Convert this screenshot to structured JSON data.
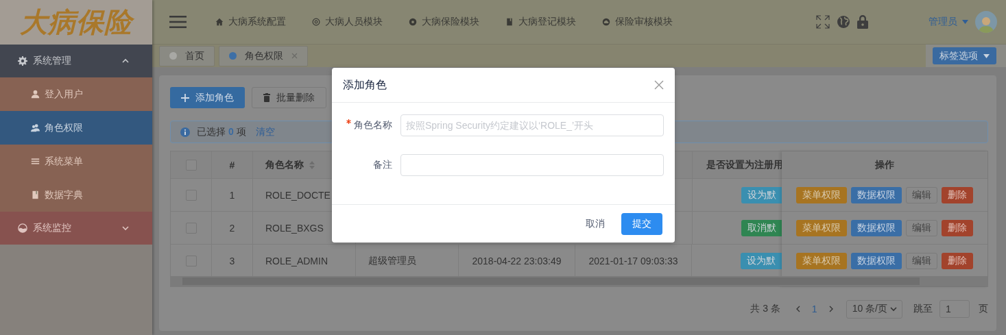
{
  "logo": "大病保险",
  "header": {
    "nav": [
      {
        "label": "大病系统配置"
      },
      {
        "label": "大病人员模块"
      },
      {
        "label": "大病保险模块"
      },
      {
        "label": "大病登记模块"
      },
      {
        "label": "保险审核模块"
      }
    ],
    "user": "管理员"
  },
  "tabs": [
    {
      "label": "首页",
      "selected": false,
      "closable": false
    },
    {
      "label": "角色权限",
      "selected": true,
      "closable": true
    }
  ],
  "tab_options": "标签选项",
  "sidebar": {
    "items": [
      {
        "label": "系统管理",
        "expanded": true,
        "children": [
          {
            "label": "登入用户",
            "selected": false
          },
          {
            "label": "角色权限",
            "selected": true
          },
          {
            "label": "系统菜单",
            "selected": false
          },
          {
            "label": "数据字典",
            "selected": false
          }
        ]
      },
      {
        "label": "系统监控",
        "expanded": false
      }
    ]
  },
  "toolbar": [
    {
      "label": "添加角色",
      "kind": "primary"
    },
    {
      "label": "批量删除",
      "kind": "default"
    }
  ],
  "selection": {
    "prefix": "已选择",
    "count": "0",
    "suffix": "项",
    "clear": "清空"
  },
  "table": {
    "select_all_checked": false,
    "columns": [
      {
        "label": "#"
      },
      {
        "label": "角色名称",
        "sortable": true
      },
      {
        "label": "是否设置为注册用"
      },
      {
        "label": "操作"
      }
    ],
    "rows": [
      {
        "checked": false,
        "index": "1",
        "name": "ROLE_DOCTE",
        "default_action": {
          "label": "设为默",
          "kind": "set"
        },
        "actions": [
          {
            "label": "菜单权限",
            "kind": "warning"
          },
          {
            "label": "数据权限",
            "kind": "primary"
          },
          {
            "label": "编辑",
            "kind": "default"
          },
          {
            "label": "删除",
            "kind": "danger"
          }
        ]
      },
      {
        "checked": false,
        "index": "2",
        "name": "ROLE_BXGS",
        "default_action": {
          "label": "取消默",
          "kind": "unset"
        },
        "actions": [
          {
            "label": "菜单权限",
            "kind": "warning"
          },
          {
            "label": "数据权限",
            "kind": "primary"
          },
          {
            "label": "编辑",
            "kind": "default"
          },
          {
            "label": "删除",
            "kind": "danger"
          }
        ]
      },
      {
        "checked": false,
        "index": "3",
        "name": "ROLE_ADMIN",
        "remark": "超级管理员",
        "created": "2018-04-22 23:03:49",
        "updated": "2021-01-17 09:03:33",
        "default_action": {
          "label": "设为默",
          "kind": "set"
        },
        "actions": [
          {
            "label": "菜单权限",
            "kind": "warning"
          },
          {
            "label": "数据权限",
            "kind": "primary"
          },
          {
            "label": "编辑",
            "kind": "default"
          },
          {
            "label": "删除",
            "kind": "danger"
          }
        ]
      }
    ]
  },
  "pagination": {
    "total": "共 3 条",
    "pages": [
      {
        "label": "1",
        "selected": true
      }
    ],
    "page_size": "10 条/页",
    "jump_label": "跳至",
    "jump_value": "1",
    "page_suffix": "页"
  },
  "dialog": {
    "title": "添加角色",
    "fields": [
      {
        "label": "角色名称",
        "required": true,
        "placeholder": "按照Spring Security约定建议以‘ROLE_’开头"
      },
      {
        "label": "备注",
        "required": false
      }
    ],
    "buttons": [
      {
        "label": "取消",
        "kind": "text"
      },
      {
        "label": "提交",
        "kind": "primary"
      }
    ]
  }
}
